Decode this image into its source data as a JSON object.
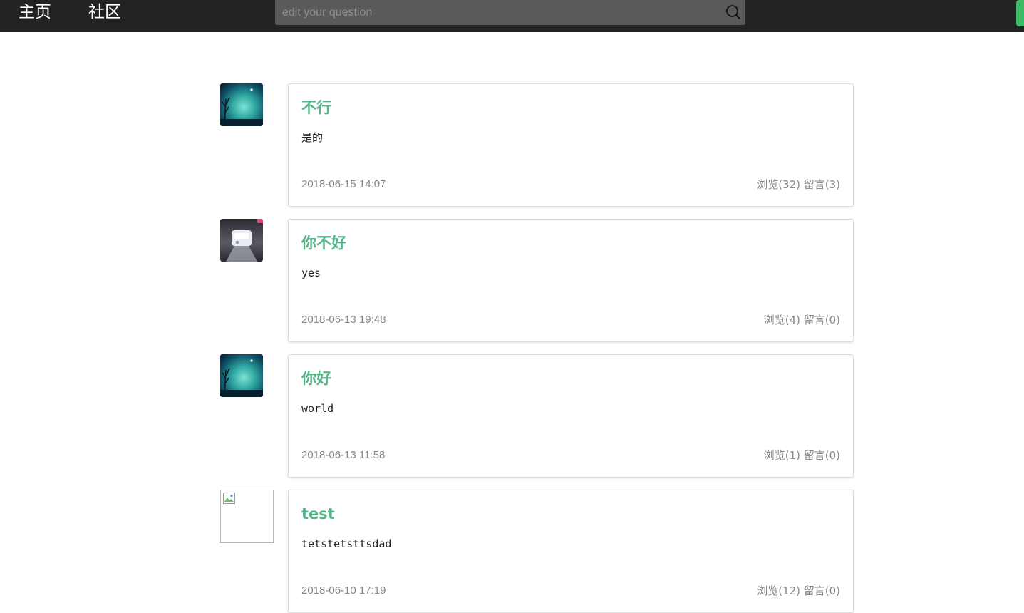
{
  "nav": {
    "home": "主页",
    "community": "社区"
  },
  "search": {
    "placeholder": "edit your question"
  },
  "colors": {
    "accent": "#52b788",
    "navbar": "#222222",
    "corner_tab": "#3cba64"
  },
  "posts": [
    {
      "title": "不行",
      "body": "是的",
      "date": "2018-06-15 14:07",
      "stats": "浏览(32) 留言(3)",
      "avatar": "night-sky-avatar"
    },
    {
      "title": "你不好",
      "body": "yes",
      "date": "2018-06-13 19:48",
      "stats": "浏览(4) 留言(0)",
      "avatar": "projector-avatar"
    },
    {
      "title": "你好",
      "body": "world",
      "date": "2018-06-13 11:58",
      "stats": "浏览(1) 留言(0)",
      "avatar": "night-sky-avatar"
    },
    {
      "title": "test",
      "body": "tetstetsttsdad",
      "date": "2018-06-10 17:19",
      "stats": "浏览(12) 留言(0)",
      "avatar": "broken-image-avatar"
    }
  ]
}
